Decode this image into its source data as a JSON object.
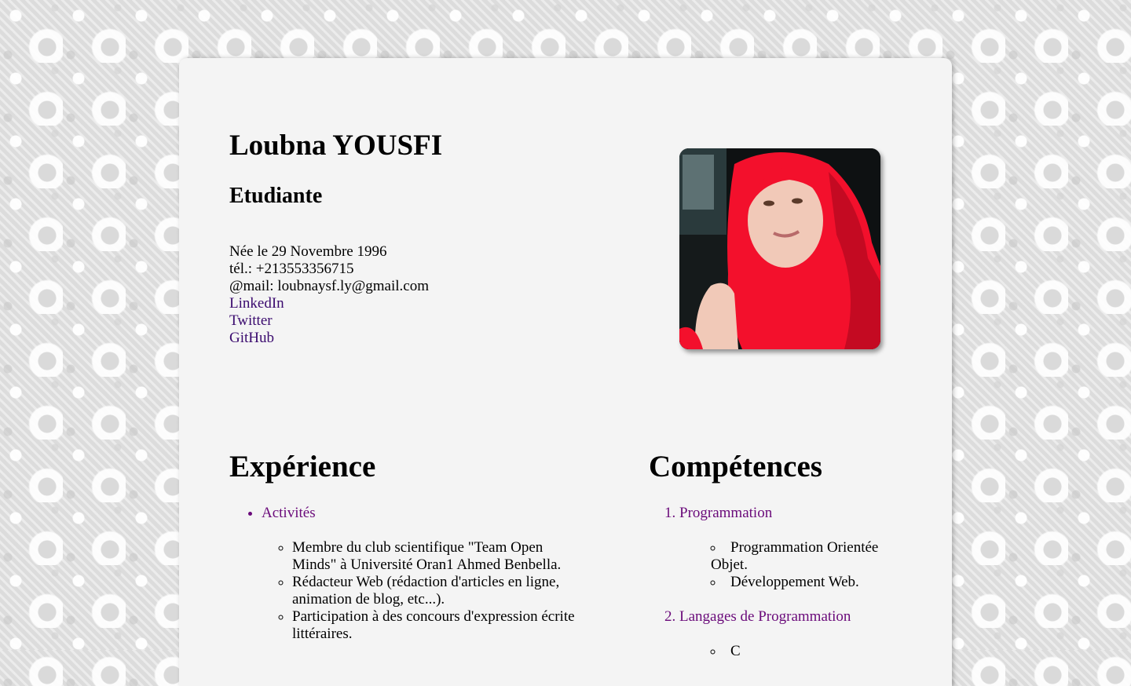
{
  "header": {
    "name": "Loubna YOUSFI",
    "role": "Etudiante"
  },
  "info": {
    "birth": "Née le 29 Novembre 1996",
    "phone": "tél.: +213553356715",
    "email": "@mail: loubnaysf.ly@gmail.com",
    "links": [
      "LinkedIn",
      "Twitter",
      "GitHub"
    ]
  },
  "experience": {
    "title": "Expérience",
    "category": "Activités",
    "items": [
      "Membre du club scientifique \"Team Open Minds\" à Université Oran1 Ahmed Benbella.",
      "Rédacteur Web (rédaction d'articles en ligne, animation de blog, etc...).",
      "Participation à des concours d'expression écrite littéraires."
    ]
  },
  "skills": {
    "title": "Compétences",
    "categories": [
      {
        "label": "Programmation",
        "items": [
          "Programmation Orientée Objet.",
          "Développement Web."
        ]
      },
      {
        "label": "Langages de Programmation",
        "items": [
          "C"
        ]
      }
    ]
  },
  "colors": {
    "link": "#3a0a6e",
    "visited_link": "#6a0a7a",
    "card": "#f4f4f4",
    "scarf": "#ff1030"
  },
  "icons": [
    "profile-photo"
  ]
}
